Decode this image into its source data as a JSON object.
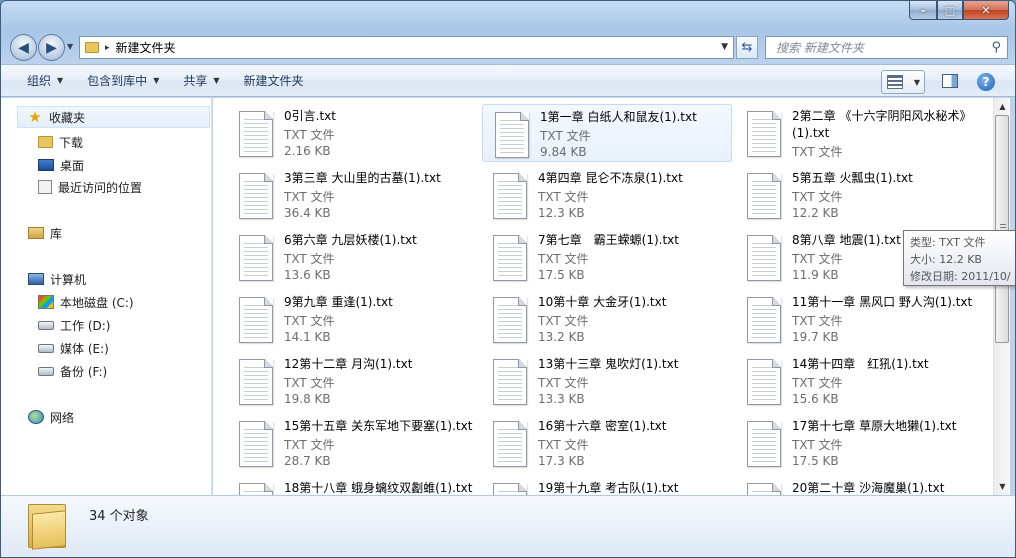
{
  "window": {
    "caption": {
      "minimize": "–",
      "maximize": "□",
      "close": "✕"
    }
  },
  "nav": {
    "back_icon": "◀",
    "forward_icon": "▶",
    "address": {
      "separator": "▸",
      "path": "新建文件夹"
    },
    "refresh_icon": "⇆",
    "search": {
      "placeholder": "搜索 新建文件夹",
      "icon": "⚲"
    }
  },
  "toolbar": {
    "organize": "组织",
    "include_in_library": "包含到库中",
    "share": "共享",
    "new_folder": "新建文件夹",
    "help": "?"
  },
  "sidebar": {
    "favorites": {
      "label": "收藏夹",
      "icon": "★"
    },
    "favorite_items": [
      {
        "label": "下载"
      },
      {
        "label": "桌面"
      },
      {
        "label": "最近访问的位置"
      }
    ],
    "libraries": {
      "label": "库"
    },
    "computer": {
      "label": "计算机"
    },
    "drives": [
      {
        "label": "本地磁盘 (C:)"
      },
      {
        "label": "工作 (D:)"
      },
      {
        "label": "媒体 (E:)"
      },
      {
        "label": "备份 (F:)"
      }
    ],
    "network": {
      "label": "网络"
    }
  },
  "files": [
    {
      "name": "0引言.txt",
      "type": "TXT 文件",
      "size": "2.16 KB"
    },
    {
      "name": "1第一章 白纸人和鼠友(1).txt",
      "type": "TXT 文件",
      "size": "9.84 KB"
    },
    {
      "name": "2第二章 《十六字阴阳风水秘术》(1).txt",
      "type": "TXT 文件",
      "size": ""
    },
    {
      "name": "3第三章 大山里的古墓(1).txt",
      "type": "TXT 文件",
      "size": "36.4 KB"
    },
    {
      "name": "4第四章 昆仑不冻泉(1).txt",
      "type": "TXT 文件",
      "size": "12.3 KB"
    },
    {
      "name": "5第五章 火瓢虫(1).txt",
      "type": "TXT 文件",
      "size": "12.2 KB"
    },
    {
      "name": "6第六章 九层妖楼(1).txt",
      "type": "TXT 文件",
      "size": "13.6 KB"
    },
    {
      "name": "7第七章　霸王蝾螈(1).txt",
      "type": "TXT 文件",
      "size": "17.5 KB"
    },
    {
      "name": "8第八章 地震(1).txt",
      "type": "TXT 文件",
      "size": "11.9 KB"
    },
    {
      "name": "9第九章 重逢(1).txt",
      "type": "TXT 文件",
      "size": "14.1 KB"
    },
    {
      "name": "10第十章 大金牙(1).txt",
      "type": "TXT 文件",
      "size": "13.2 KB"
    },
    {
      "name": "11第十一章 黑风口 野人沟(1).txt",
      "type": "TXT 文件",
      "size": "19.7 KB"
    },
    {
      "name": "12第十二章 月沟(1).txt",
      "type": "TXT 文件",
      "size": "19.8 KB"
    },
    {
      "name": "13第十三章 鬼吹灯(1).txt",
      "type": "TXT 文件",
      "size": "13.3 KB"
    },
    {
      "name": "14第十四章　红犼(1).txt",
      "type": "TXT 文件",
      "size": "15.6 KB"
    },
    {
      "name": "15第十五章 关东军地下要塞(1).txt",
      "type": "TXT 文件",
      "size": "28.7 KB"
    },
    {
      "name": "16第十六章 密室(1).txt",
      "type": "TXT 文件",
      "size": "17.3 KB"
    },
    {
      "name": "17第十七章 草原大地獭(1).txt",
      "type": "TXT 文件",
      "size": "17.5 KB"
    },
    {
      "name": "18第十八章 蛾身螭纹双劙蜼(1).txt",
      "type": "",
      "size": ""
    },
    {
      "name": "19第十九章 考古队(1).txt",
      "type": "",
      "size": ""
    },
    {
      "name": "20第二十章 沙海魔巢(1).txt",
      "type": "",
      "size": ""
    }
  ],
  "tooltip": {
    "type_line": "类型: TXT 文件",
    "size_line": "大小: 12.2 KB",
    "date_line": "修改日期: 2011/10/"
  },
  "scrollbar": {
    "up": "▲",
    "down": "▼"
  },
  "details": {
    "count": "34 个对象"
  }
}
